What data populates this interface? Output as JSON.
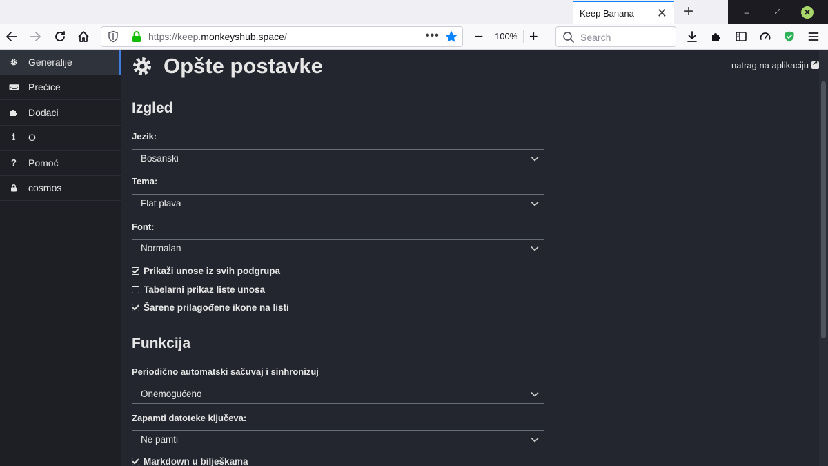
{
  "browser": {
    "tab_title": "Keep Banana",
    "url_prefix": "https://keep.",
    "url_domain": "monkeyshub.space",
    "url_suffix": "/",
    "zoom": "100%",
    "search_placeholder": "Search"
  },
  "sidebar": {
    "items": [
      {
        "label": "Generalije",
        "icon": "gear-icon"
      },
      {
        "label": "Prečice",
        "icon": "keyboard-icon"
      },
      {
        "label": "Dodaci",
        "icon": "puzzle-icon"
      },
      {
        "label": "O",
        "icon": "info-icon"
      },
      {
        "label": "Pomoć",
        "icon": "question-icon"
      },
      {
        "label": "cosmos",
        "icon": "lock-icon"
      }
    ]
  },
  "main": {
    "title": "Opšte postavke",
    "back_link": "natrag na aplikaciju",
    "section_appearance": "Izgled",
    "language_label": "Jezik:",
    "language_value": "Bosanski",
    "theme_label": "Tema:",
    "theme_value": "Flat plava",
    "font_label": "Font:",
    "font_value": "Normalan",
    "check_subgroups": "Prikaži unose iz svih podgrupa",
    "check_table": "Tabelarni prikaz liste unosa",
    "check_icons": "Šarene prilagođene ikone na listi",
    "section_function": "Funkcija",
    "autosave_label": "Periodično automatski sačuvaj i sinhronizuj",
    "autosave_value": "Onemogućeno",
    "keyfiles_label": "Zapamti datoteke ključeva:",
    "keyfiles_value": "Ne pamti",
    "check_markdown": "Markdown u bilješkama"
  },
  "colors": {
    "background": "#23262e",
    "sidebar": "#1d1f24",
    "accent": "#3f7be0"
  }
}
